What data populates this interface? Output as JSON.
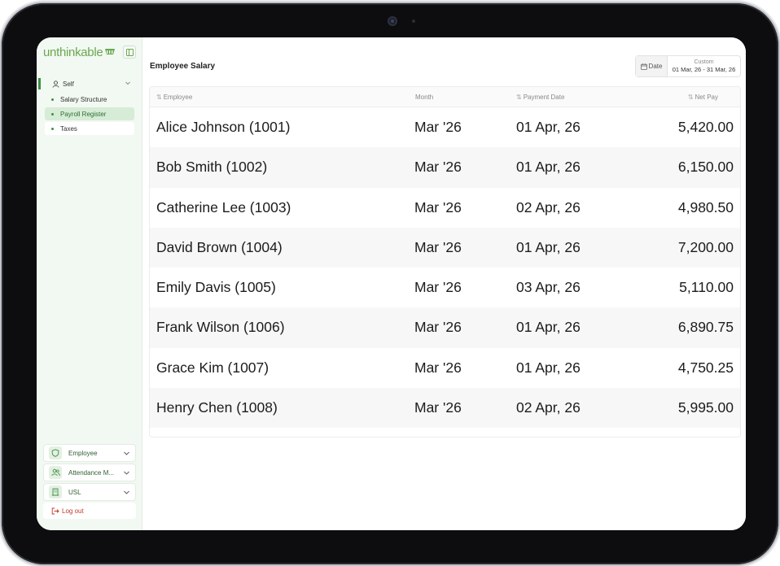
{
  "app": {
    "logo_text": "unthinkable"
  },
  "sidebar": {
    "section": {
      "label": "Self"
    },
    "items": [
      {
        "label": "Salary Structure",
        "active": false
      },
      {
        "label": "Payroll Register",
        "active": true
      },
      {
        "label": "Taxes",
        "active": false
      }
    ],
    "bottom": [
      {
        "label": "Employee",
        "icon": "shield-icon"
      },
      {
        "label": "Attendance M...",
        "icon": "users-icon"
      },
      {
        "label": "USL",
        "icon": "building-icon"
      }
    ],
    "logout_label": "Log out"
  },
  "header": {
    "title": "Employee Salary",
    "date_filter": {
      "button_label": "Date",
      "mode": "Custom",
      "range": "01 Mar, 26 - 31 Mar, 26"
    }
  },
  "table": {
    "columns": [
      {
        "label": "Employee",
        "sortable": true
      },
      {
        "label": "Month",
        "sortable": false
      },
      {
        "label": "Payment Date",
        "sortable": true
      },
      {
        "label": "Net Pay",
        "sortable": true
      }
    ],
    "rows": [
      {
        "employee": "Alice Johnson (1001)",
        "month": "Mar '26",
        "payment_date": "01 Apr, 26",
        "net_pay": "5,420.00"
      },
      {
        "employee": "Bob Smith (1002)",
        "month": "Mar '26",
        "payment_date": "01 Apr, 26",
        "net_pay": "6,150.00"
      },
      {
        "employee": "Catherine Lee (1003)",
        "month": "Mar '26",
        "payment_date": "02 Apr, 26",
        "net_pay": "4,980.50"
      },
      {
        "employee": "David Brown (1004)",
        "month": "Mar '26",
        "payment_date": "01 Apr, 26",
        "net_pay": "7,200.00"
      },
      {
        "employee": "Emily Davis (1005)",
        "month": "Mar '26",
        "payment_date": "03 Apr, 26",
        "net_pay": "5,110.00"
      },
      {
        "employee": "Frank Wilson (1006)",
        "month": "Mar '26",
        "payment_date": "01 Apr, 26",
        "net_pay": "6,890.75"
      },
      {
        "employee": "Grace Kim (1007)",
        "month": "Mar '26",
        "payment_date": "01 Apr, 26",
        "net_pay": "4,750.25"
      },
      {
        "employee": "Henry Chen (1008)",
        "month": "Mar '26",
        "payment_date": "02 Apr, 26",
        "net_pay": "5,995.00"
      }
    ]
  },
  "colors": {
    "brand": "#6aa84f",
    "accent": "#3e8e41",
    "active_bg": "#d7ecd7",
    "logout": "#c0392b"
  }
}
